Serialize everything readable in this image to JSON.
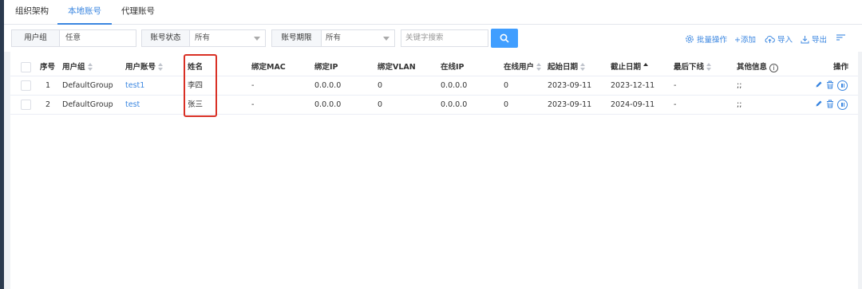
{
  "tabs": [
    {
      "label": "组织架构"
    },
    {
      "label": "本地账号",
      "active": true
    },
    {
      "label": "代理账号"
    }
  ],
  "filters": {
    "user_group": {
      "label": "用户组",
      "value": "任意"
    },
    "account_status": {
      "label": "账号状态",
      "value": "所有"
    },
    "account_term": {
      "label": "账号期限",
      "value": "所有"
    },
    "keyword": {
      "placeholder": "关键字搜索"
    }
  },
  "toolbar": {
    "batch": "批量操作",
    "add": "+添加",
    "import": "导入",
    "export": "导出"
  },
  "table": {
    "columns": {
      "index": "序号",
      "group": "用户组",
      "account": "用户账号",
      "name": "姓名",
      "mac": "绑定MAC",
      "ip": "绑定IP",
      "vlan": "绑定VLAN",
      "online_ip": "在线IP",
      "online_user": "在线用户",
      "start": "起始日期",
      "end": "截止日期",
      "last_offline": "最后下线",
      "other": "其他信息",
      "actions": "操作"
    },
    "rows": [
      {
        "index": "1",
        "group": "DefaultGroup",
        "account": "test1",
        "name": "李四",
        "mac": "-",
        "ip": "0.0.0.0",
        "vlan": "0",
        "online_ip": "0.0.0.0",
        "online_user": "0",
        "start": "2023-09-11",
        "end": "2023-12-11",
        "last_offline": "-",
        "other": ";;"
      },
      {
        "index": "2",
        "group": "DefaultGroup",
        "account": "test",
        "name": "张三",
        "mac": "-",
        "ip": "0.0.0.0",
        "vlan": "0",
        "online_ip": "0.0.0.0",
        "online_user": "0",
        "start": "2023-09-11",
        "end": "2024-09-11",
        "last_offline": "-",
        "other": ";;"
      }
    ]
  },
  "colors": {
    "accent": "#409eff",
    "highlight": "#d93025"
  }
}
